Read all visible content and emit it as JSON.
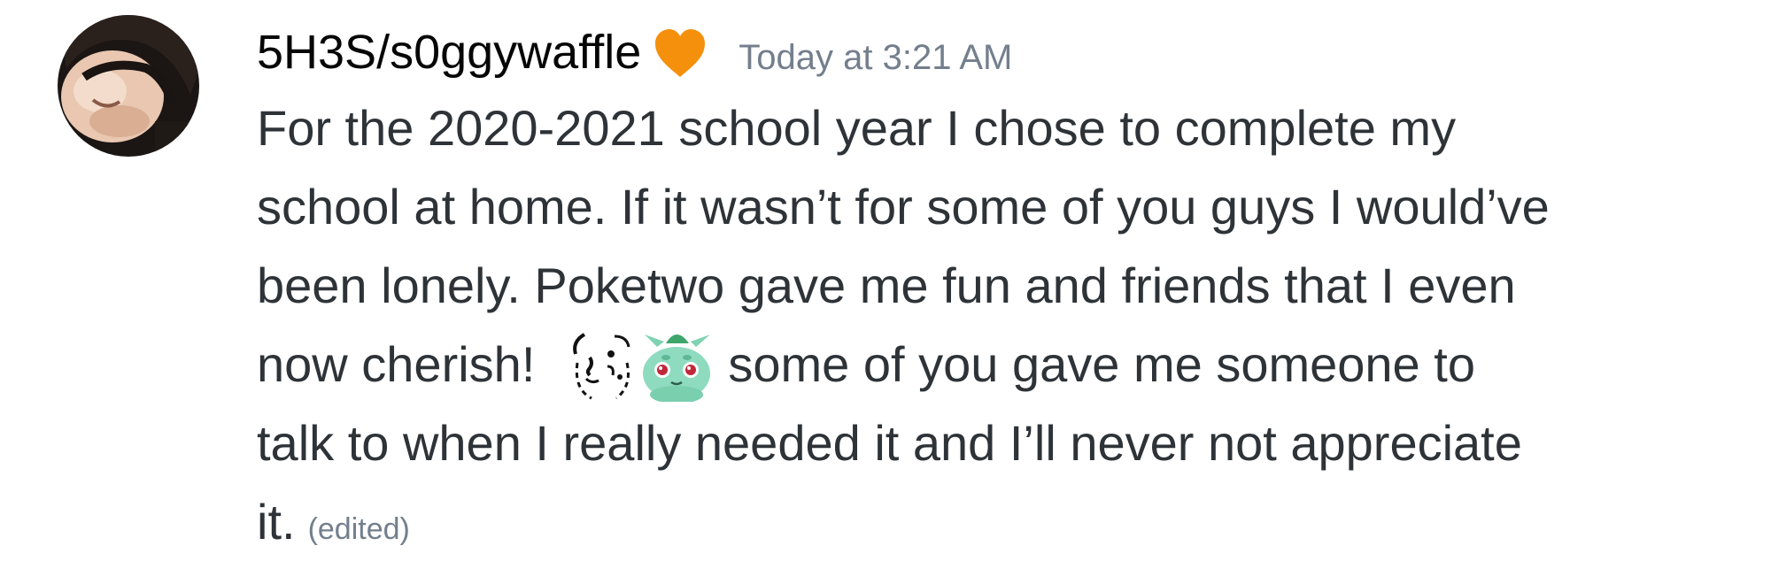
{
  "message": {
    "author": "5H3S/s0ggywaffle",
    "badge_icon": "orange-heart-icon",
    "timestamp": "Today at 3:21 AM",
    "lines": {
      "l1": "For the 2020-2021 school year I chose to complete my",
      "l2": "school at home. If it wasn’t for some of you guys I would’ve",
      "l3": "been lonely. Poketwo gave me fun and friends that I even",
      "l4_pre": "now cherish!",
      "l4_post": "some of you gave me someone to",
      "l5": "talk to when I really needed it and I’ll never not appreciate",
      "l6": "it."
    },
    "emojis": [
      "sparkle-face-emoji-icon",
      "crying-bulbasaur-emoji-icon"
    ],
    "edited_label": "(edited)"
  },
  "colors": {
    "username": "#060607",
    "text": "#2e3338",
    "muted": "#747f8d",
    "heart": "#f4900c"
  }
}
